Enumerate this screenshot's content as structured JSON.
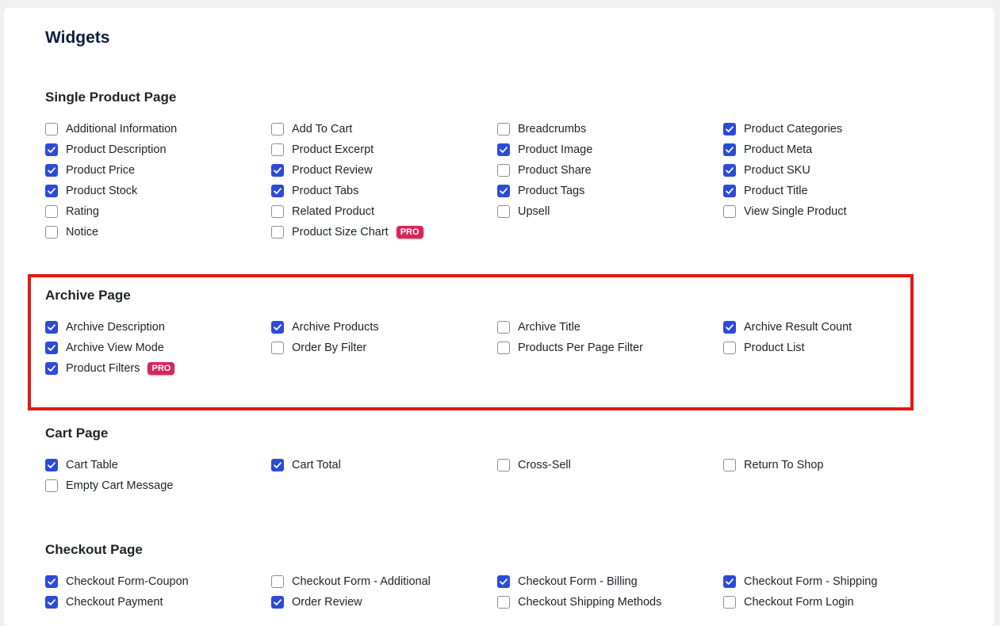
{
  "page": {
    "title": "Widgets"
  },
  "colors": {
    "accent": "#2c4bd9",
    "pro_badge": "#d7265b",
    "highlight": "#e21717"
  },
  "sections": [
    {
      "title": "Single Product Page",
      "items": [
        {
          "label": "Additional Information",
          "checked": false
        },
        {
          "label": "Add To Cart",
          "checked": false
        },
        {
          "label": "Breadcrumbs",
          "checked": false
        },
        {
          "label": "Product Categories",
          "checked": true
        },
        {
          "label": "Product Description",
          "checked": true
        },
        {
          "label": "Product Excerpt",
          "checked": false
        },
        {
          "label": "Product Image",
          "checked": true
        },
        {
          "label": "Product Meta",
          "checked": true
        },
        {
          "label": "Product Price",
          "checked": true
        },
        {
          "label": "Product Review",
          "checked": true
        },
        {
          "label": "Product Share",
          "checked": false
        },
        {
          "label": "Product SKU",
          "checked": true
        },
        {
          "label": "Product Stock",
          "checked": true
        },
        {
          "label": "Product Tabs",
          "checked": true
        },
        {
          "label": "Product Tags",
          "checked": true
        },
        {
          "label": "Product Title",
          "checked": true
        },
        {
          "label": "Rating",
          "checked": false
        },
        {
          "label": "Related Product",
          "checked": false
        },
        {
          "label": "Upsell",
          "checked": false
        },
        {
          "label": "View Single Product",
          "checked": false
        },
        {
          "label": "Notice",
          "checked": false
        },
        {
          "label": "Product Size Chart",
          "checked": false,
          "badge": "PRO"
        }
      ]
    },
    {
      "title": "Archive Page",
      "items": [
        {
          "label": "Archive Description",
          "checked": true
        },
        {
          "label": "Archive Products",
          "checked": true
        },
        {
          "label": "Archive Title",
          "checked": false
        },
        {
          "label": "Archive Result Count",
          "checked": true
        },
        {
          "label": "Archive View Mode",
          "checked": true
        },
        {
          "label": "Order By Filter",
          "checked": false
        },
        {
          "label": "Products Per Page Filter",
          "checked": false
        },
        {
          "label": "Product List",
          "checked": false
        },
        {
          "label": "Product Filters",
          "checked": true,
          "badge": "PRO"
        }
      ]
    },
    {
      "title": "Cart Page",
      "items": [
        {
          "label": "Cart Table",
          "checked": true
        },
        {
          "label": "Cart Total",
          "checked": true
        },
        {
          "label": "Cross-Sell",
          "checked": false
        },
        {
          "label": "Return To Shop",
          "checked": false
        },
        {
          "label": "Empty Cart Message",
          "checked": false
        }
      ]
    },
    {
      "title": "Checkout Page",
      "items": [
        {
          "label": "Checkout Form-Coupon",
          "checked": true
        },
        {
          "label": "Checkout Form - Additional",
          "checked": false
        },
        {
          "label": "Checkout Form - Billing",
          "checked": true
        },
        {
          "label": "Checkout Form - Shipping",
          "checked": true
        },
        {
          "label": "Checkout Payment",
          "checked": true
        },
        {
          "label": "Order Review",
          "checked": true
        },
        {
          "label": "Checkout Shipping Methods",
          "checked": false
        },
        {
          "label": "Checkout Form Login",
          "checked": false
        }
      ]
    }
  ]
}
